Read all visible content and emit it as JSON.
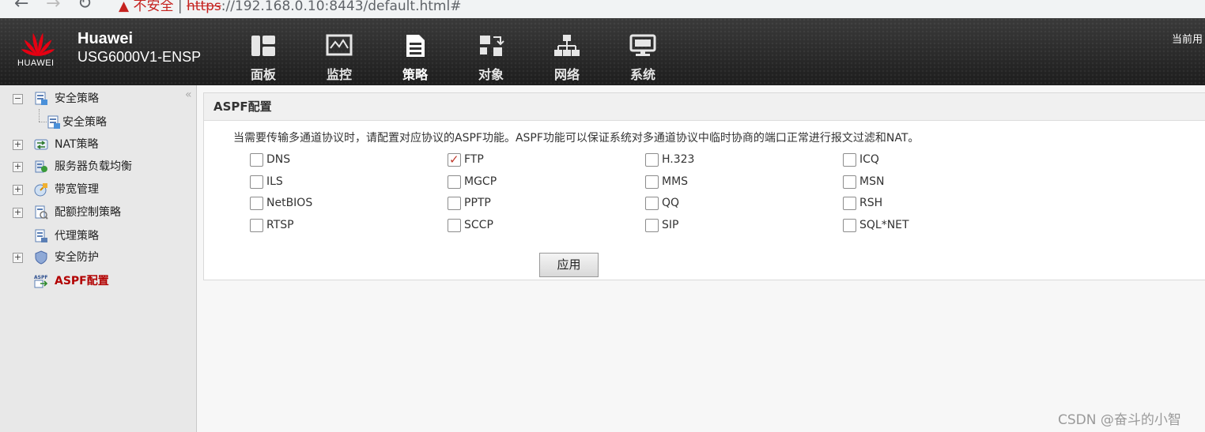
{
  "browser": {
    "warning_text": "不安全",
    "url_scheme": "https",
    "url_rest": "://192.168.0.10:8443/default.html#"
  },
  "header": {
    "logo_text": "HUAWEI",
    "brand_name": "Huawei",
    "model": "USG6000V1-ENSP",
    "user_text": "当前用",
    "nav": [
      {
        "label": "面板",
        "icon": "dashboard-icon"
      },
      {
        "label": "监控",
        "icon": "monitor-icon"
      },
      {
        "label": "策略",
        "icon": "policy-icon"
      },
      {
        "label": "对象",
        "icon": "object-icon"
      },
      {
        "label": "网络",
        "icon": "network-icon"
      },
      {
        "label": "系统",
        "icon": "system-icon"
      }
    ],
    "active_nav": "策略"
  },
  "sidebar": {
    "collapse_glyph": "«",
    "items": [
      {
        "label": "安全策略",
        "expander": "−"
      },
      {
        "label": "安全策略"
      },
      {
        "label": "NAT策略",
        "expander": "+"
      },
      {
        "label": "服务器负载均衡",
        "expander": "+"
      },
      {
        "label": "带宽管理",
        "expander": "+"
      },
      {
        "label": "配额控制策略",
        "expander": "+"
      },
      {
        "label": "代理策略"
      },
      {
        "label": "安全防护",
        "expander": "+"
      },
      {
        "label": "ASPF配置"
      }
    ],
    "active_item": "ASPF配置"
  },
  "main": {
    "panel_title": "ASPF配置",
    "description": "当需要传输多通道协议时，请配置对应协议的ASPF功能。ASPF功能可以保证系统对多通道协议中临时协商的端口正常进行报文过滤和NAT。",
    "protocols": [
      {
        "label": "DNS",
        "checked": false
      },
      {
        "label": "FTP",
        "checked": true
      },
      {
        "label": "H.323",
        "checked": false
      },
      {
        "label": "ICQ",
        "checked": false
      },
      {
        "label": "ILS",
        "checked": false
      },
      {
        "label": "MGCP",
        "checked": false
      },
      {
        "label": "MMS",
        "checked": false
      },
      {
        "label": "MSN",
        "checked": false
      },
      {
        "label": "NetBIOS",
        "checked": false
      },
      {
        "label": "PPTP",
        "checked": false
      },
      {
        "label": "QQ",
        "checked": false
      },
      {
        "label": "RSH",
        "checked": false
      },
      {
        "label": "RTSP",
        "checked": false
      },
      {
        "label": "SCCP",
        "checked": false
      },
      {
        "label": "SIP",
        "checked": false
      },
      {
        "label": "SQL*NET",
        "checked": false
      }
    ],
    "apply_label": "应用"
  },
  "watermark": "CSDN @奋斗的小智",
  "colors": {
    "active_sidebar": "#b20000",
    "check": "#c0392b",
    "header_bg": "#262626",
    "logo_red": "#e60012"
  }
}
